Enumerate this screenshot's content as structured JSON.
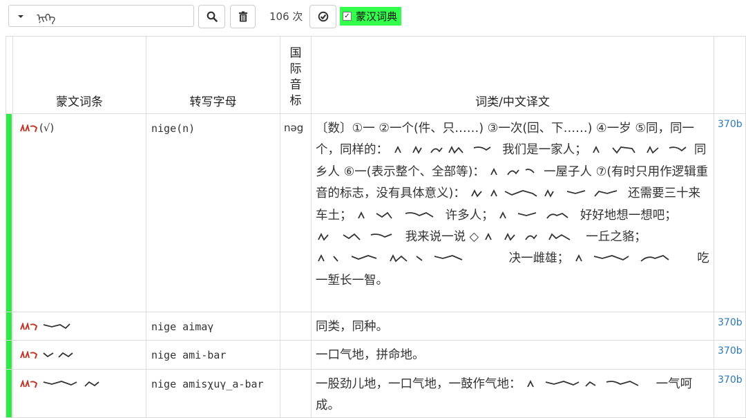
{
  "search": {
    "query": "ᠨᠢᠭᠡ"
  },
  "count": "106 次",
  "dict_label": "蒙汉词典",
  "headers": {
    "headword": "蒙文词条",
    "translit": "转写字母",
    "ipa": "国际音标",
    "definition": "词类/中文译文"
  },
  "rows": [
    {
      "headword_suffix": "(√)",
      "translit": "nige(n)",
      "ipa": "nəg",
      "page": "370b",
      "def": {
        "p1": "〔数〕①一 ②一个(件、只……) ③一次(回、下……) ④一岁 ⑤同，同一个，同样的：",
        "p2": "我们是一家人；",
        "p3": "同乡人 ⑥一(表示整个、全部等)：",
        "p4": "一屋子人 ⑦(有时只用作逻辑重音的标志，没有具体意义)：",
        "p5": "还需要三十来车土；",
        "p6": "许多人；",
        "p7": "好好地想一想吧；",
        "p8": "我来说一说 ◇",
        "p9": "一丘之貉；",
        "p10": "决一雌雄；",
        "p11": "吃一堑长一智。"
      }
    },
    {
      "translit": "nige aimaγ",
      "page": "370b",
      "def": {
        "p1": "同类，同种。"
      }
    },
    {
      "translit": "nige ami-bar",
      "page": "370b",
      "def": {
        "p1": "一口气地，拼命地。"
      }
    },
    {
      "translit": "nige amisχuγ_a-bar",
      "page": "370b",
      "def": {
        "p1": "一股劲儿地，一口气地，一鼓作气地：",
        "p2": "一气呵成。"
      }
    }
  ]
}
